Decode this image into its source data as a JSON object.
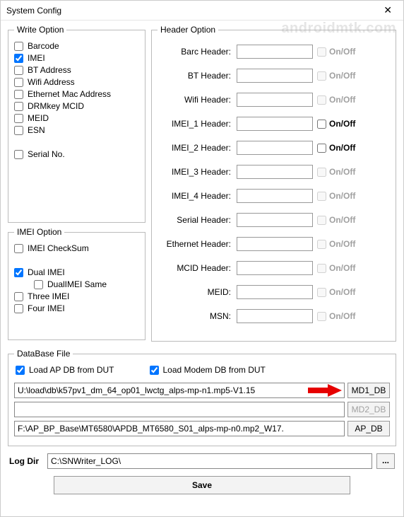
{
  "window": {
    "title": "System Config",
    "close_glyph": "✕"
  },
  "watermark": "androidmtk.com",
  "write_option": {
    "legend": "Write Option",
    "items": [
      {
        "label": "Barcode",
        "checked": false
      },
      {
        "label": "IMEI",
        "checked": true
      },
      {
        "label": "BT Address",
        "checked": false
      },
      {
        "label": "Wifi Address",
        "checked": false
      },
      {
        "label": "Ethernet Mac Address",
        "checked": false
      },
      {
        "label": "DRMkey MCID",
        "checked": false
      },
      {
        "label": "MEID",
        "checked": false
      },
      {
        "label": "ESN",
        "checked": false
      }
    ],
    "serial": {
      "label": "Serial No.",
      "checked": false
    }
  },
  "imei_option": {
    "legend": "IMEI Option",
    "checksum": {
      "label": "IMEI CheckSum",
      "checked": false
    },
    "dual": {
      "label": "Dual IMEI",
      "checked": true
    },
    "dual_same": {
      "label": "DualIMEI Same",
      "checked": false
    },
    "three": {
      "label": "Three IMEI",
      "checked": false
    },
    "four": {
      "label": "Four IMEI",
      "checked": false
    }
  },
  "header_option": {
    "legend": "Header Option",
    "onoff_label": "On/Off",
    "rows": [
      {
        "label": "Barc Header:",
        "value": "",
        "onoff_checked": false,
        "enabled": false
      },
      {
        "label": "BT Header:",
        "value": "",
        "onoff_checked": false,
        "enabled": false
      },
      {
        "label": "Wifi Header:",
        "value": "",
        "onoff_checked": false,
        "enabled": false
      },
      {
        "label": "IMEI_1 Header:",
        "value": "",
        "onoff_checked": false,
        "enabled": true
      },
      {
        "label": "IMEI_2 Header:",
        "value": "",
        "onoff_checked": false,
        "enabled": true
      },
      {
        "label": "IMEI_3 Header:",
        "value": "",
        "onoff_checked": false,
        "enabled": false
      },
      {
        "label": "IMEI_4 Header:",
        "value": "",
        "onoff_checked": false,
        "enabled": false
      },
      {
        "label": "Serial Header:",
        "value": "",
        "onoff_checked": false,
        "enabled": false
      },
      {
        "label": "Ethernet Header:",
        "value": "",
        "onoff_checked": false,
        "enabled": false
      },
      {
        "label": "MCID Header:",
        "value": "",
        "onoff_checked": false,
        "enabled": false
      },
      {
        "label": "MEID:",
        "value": "",
        "onoff_checked": false,
        "enabled": false
      },
      {
        "label": "MSN:",
        "value": "",
        "onoff_checked": false,
        "enabled": false
      }
    ]
  },
  "database_file": {
    "legend": "DataBase File",
    "load_ap": {
      "label": "Load AP DB from DUT",
      "checked": true
    },
    "load_modem": {
      "label": "Load Modem DB from DUT",
      "checked": true
    },
    "md1": {
      "path": "U:\\load\\db\\k57pv1_dm_64_op01_lwctg_alps-mp-n1.mp5-V1.15",
      "button": "MD1_DB"
    },
    "md2": {
      "path": "",
      "button": "MD2_DB"
    },
    "ap": {
      "path": "F:\\AP_BP_Base\\MT6580\\APDB_MT6580_S01_alps-mp-n0.mp2_W17.",
      "button": "AP_DB"
    }
  },
  "log_dir": {
    "label": "Log Dir",
    "path": "C:\\SNWriter_LOG\\",
    "browse": "..."
  },
  "save_button": "Save"
}
